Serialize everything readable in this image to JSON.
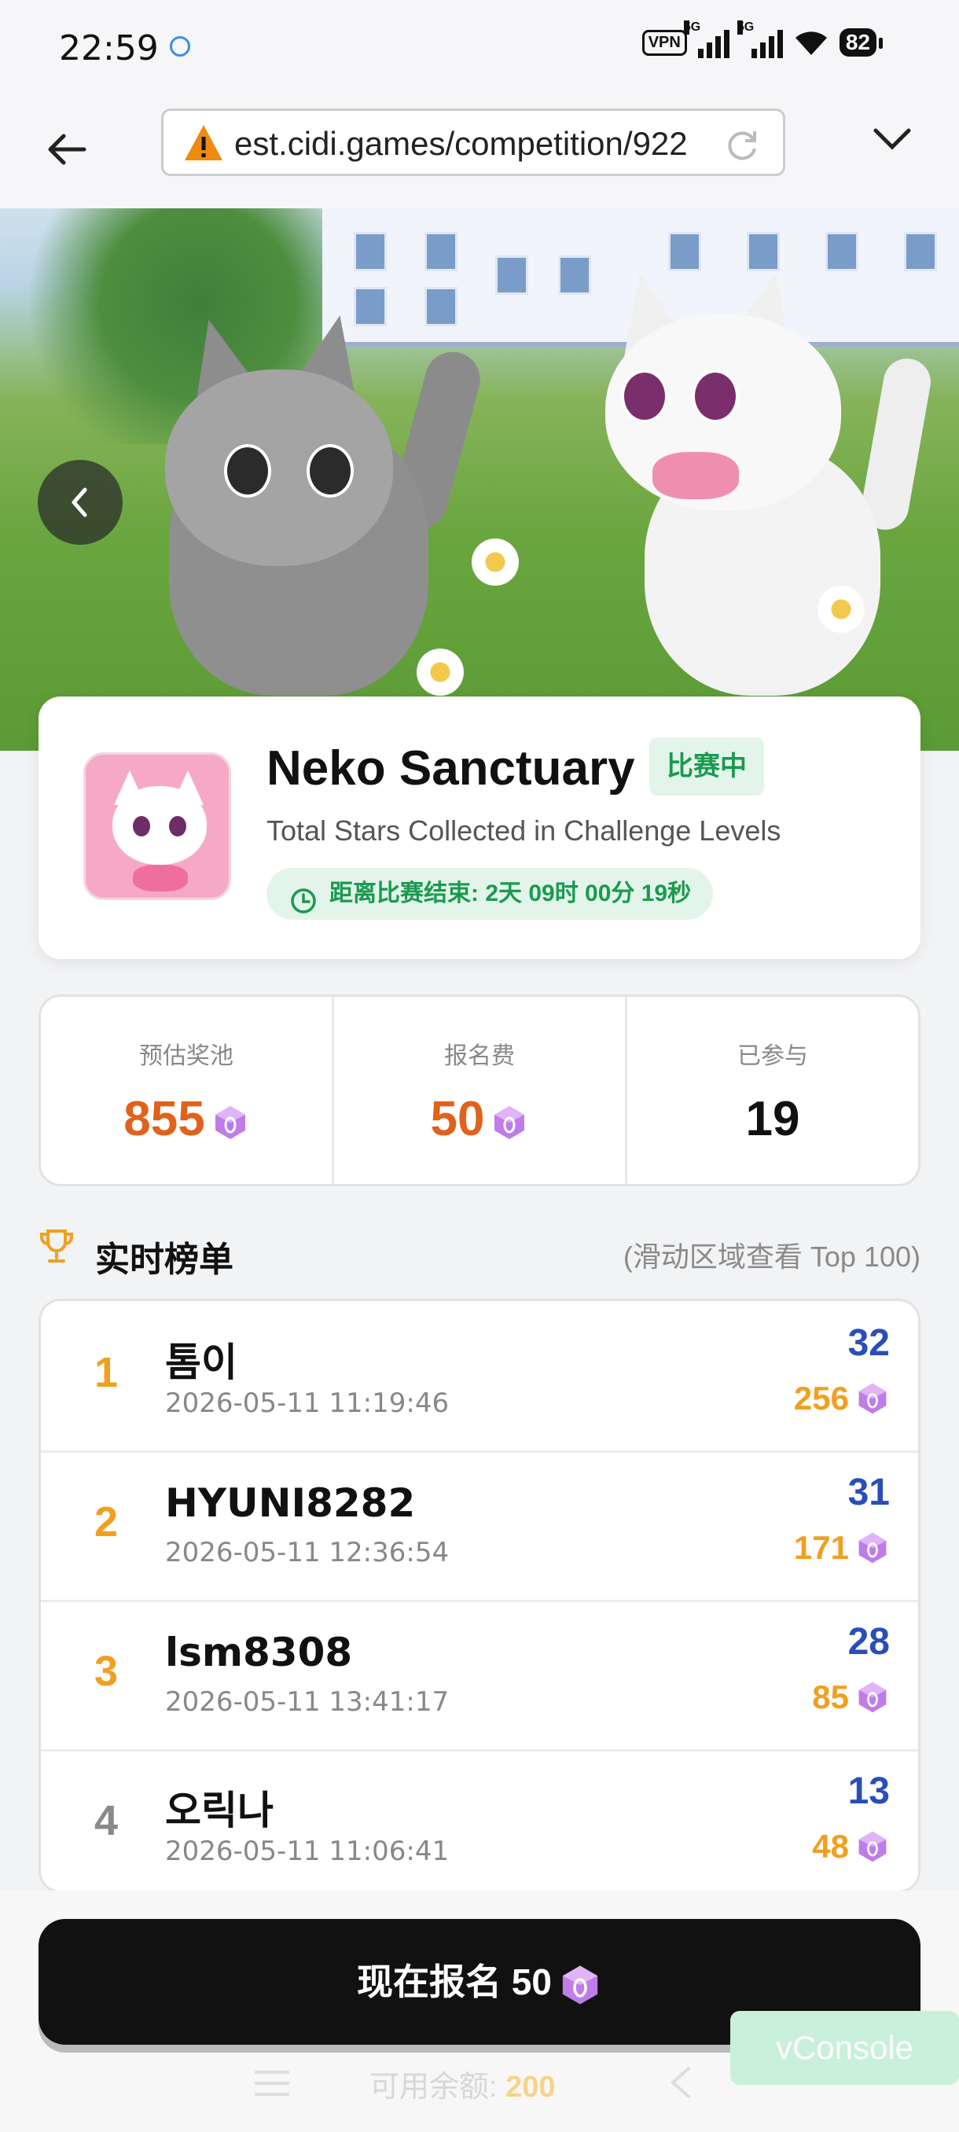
{
  "status_bar": {
    "time": "22:59",
    "vpn": "VPN",
    "signal_1": "5G",
    "signal_2": "5G",
    "battery": "82"
  },
  "browser": {
    "url": "est.cidi.games/competition/922"
  },
  "game": {
    "title": "Neko Sanctuary",
    "status_badge": "比赛中",
    "subtitle": "Total Stars Collected in Challenge Levels",
    "countdown": "距离比赛结束: 2天 09时 00分 19秒"
  },
  "stats": [
    {
      "label": "预估奖池",
      "value": "855",
      "has_gem": true
    },
    {
      "label": "报名费",
      "value": "50",
      "has_gem": true
    },
    {
      "label": "已参与",
      "value": "19",
      "has_gem": false
    }
  ],
  "leaderboard": {
    "title": "实时榜单",
    "hint": "(滑动区域查看 Top 100)",
    "rows": [
      {
        "rank": "1",
        "name": "톰이",
        "time": "2026-05-11 11:19:46",
        "score": "32",
        "reward": "256"
      },
      {
        "rank": "2",
        "name": "HYUNI8282",
        "time": "2026-05-11 12:36:54",
        "score": "31",
        "reward": "171"
      },
      {
        "rank": "3",
        "name": "lsm8308",
        "time": "2026-05-11 13:41:17",
        "score": "28",
        "reward": "85"
      },
      {
        "rank": "4",
        "name": "오릭나",
        "time": "2026-05-11 11:06:41",
        "score": "13",
        "reward": "48"
      }
    ]
  },
  "join": {
    "label": "现在报名 50"
  },
  "balance": {
    "label": "可用余额:",
    "amount": "200"
  },
  "vconsole": "vConsole",
  "colors": {
    "accent_orange": "#e0621c",
    "gold": "#f0a020",
    "score_blue": "#2a4eb8",
    "live_green": "#1a9a4e"
  }
}
